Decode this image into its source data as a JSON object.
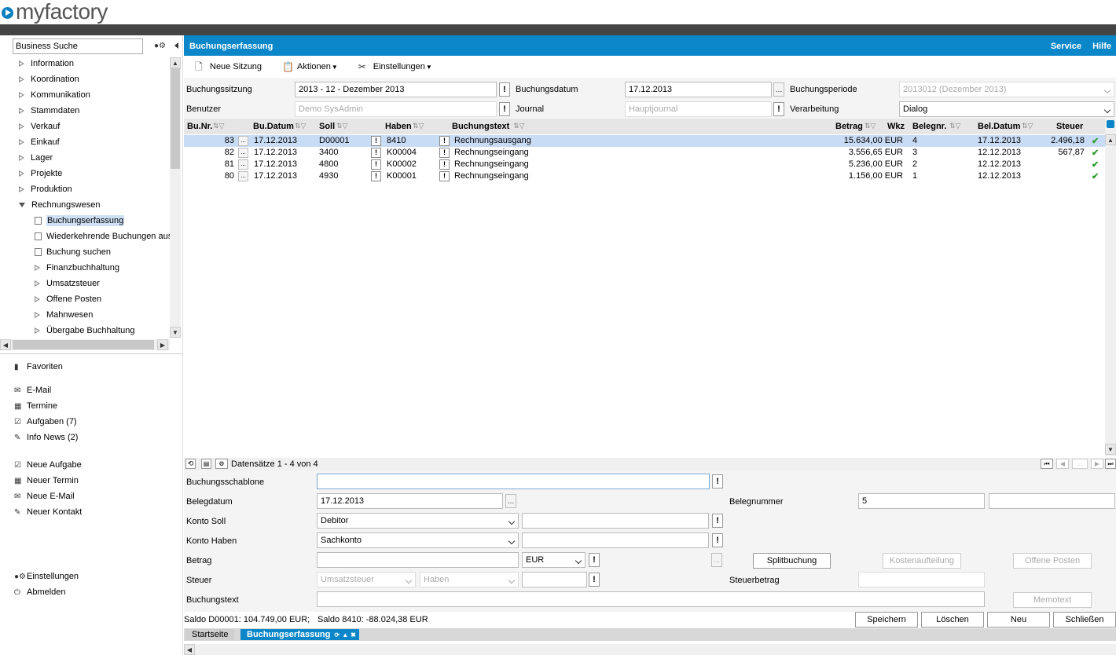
{
  "app": {
    "logo": "myfactory"
  },
  "sidebar": {
    "search_value": "Business Suche",
    "tree": [
      {
        "label": "Information",
        "type": "collapsed"
      },
      {
        "label": "Koordination",
        "type": "collapsed"
      },
      {
        "label": "Kommunikation",
        "type": "collapsed"
      },
      {
        "label": "Stammdaten",
        "type": "collapsed"
      },
      {
        "label": "Verkauf",
        "type": "collapsed"
      },
      {
        "label": "Einkauf",
        "type": "collapsed"
      },
      {
        "label": "Lager",
        "type": "collapsed"
      },
      {
        "label": "Projekte",
        "type": "collapsed"
      },
      {
        "label": "Produktion",
        "type": "collapsed"
      },
      {
        "label": "Rechnungswesen",
        "type": "expanded"
      },
      {
        "label": "Buchungserfassung",
        "type": "doc",
        "selected": true
      },
      {
        "label": "Wiederkehrende Buchungen aus",
        "type": "doc"
      },
      {
        "label": "Buchung suchen",
        "type": "doc"
      },
      {
        "label": "Finanzbuchhaltung",
        "type": "sub"
      },
      {
        "label": "Umsatzsteuer",
        "type": "sub"
      },
      {
        "label": "Offene Posten",
        "type": "sub"
      },
      {
        "label": "Mahnwesen",
        "type": "sub"
      },
      {
        "label": "Übergabe Buchhaltung",
        "type": "sub"
      }
    ],
    "favorites": "Favoriten",
    "links1": [
      {
        "label": "E-Mail",
        "icon": "mail-icon"
      },
      {
        "label": "Termine",
        "icon": "calendar-icon"
      },
      {
        "label": "Aufgaben (7)",
        "icon": "task-icon"
      },
      {
        "label": "Info News (2)",
        "icon": "news-icon"
      }
    ],
    "links2": [
      {
        "label": "Neue Aufgabe",
        "icon": "task-icon"
      },
      {
        "label": "Neuer Termin",
        "icon": "calendar-icon"
      },
      {
        "label": "Neue E-Mail",
        "icon": "mail-icon"
      },
      {
        "label": "Neuer Kontakt",
        "icon": "contact-icon"
      }
    ],
    "settings": "Einstellungen",
    "logout": "Abmelden"
  },
  "header": {
    "title": "Buchungserfassung",
    "service": "Service",
    "help": "Hilfe"
  },
  "toolbar": {
    "new_session": "Neue Sitzung",
    "actions": "Aktionen",
    "settings": "Einstellungen"
  },
  "form": {
    "session_label": "Buchungssitzung",
    "session_value": "2013 - 12 - Dezember 2013",
    "date_label": "Buchungsdatum",
    "date_value": "17.12.2013",
    "period_label": "Buchungsperiode",
    "period_value": "2013012 (Dezember 2013)",
    "user_label": "Benutzer",
    "user_value": "Demo SysAdmin",
    "journal_label": "Journal",
    "journal_value": "Hauptjournal",
    "processing_label": "Verarbeitung",
    "processing_value": "Dialog"
  },
  "grid": {
    "headers": {
      "nr": "Bu.Nr.",
      "datum": "Bu.Datum",
      "soll": "Soll",
      "haben": "Haben",
      "text": "Buchungstext",
      "betrag": "Betrag",
      "wkz": "Wkz",
      "belegnr": "Belegnr.",
      "beldatum": "Bel.Datum",
      "steuer": "Steuer"
    },
    "rows": [
      {
        "nr": "83",
        "datum": "17.12.2013",
        "soll": "D00001",
        "haben": "8410",
        "text": "Rechnungsausgang",
        "betrag": "15.634,00 EUR",
        "belegnr": "4",
        "beldatum": "17.12.2013",
        "steuer": "2.496,18",
        "check": "✔"
      },
      {
        "nr": "82",
        "datum": "17.12.2013",
        "soll": "3400",
        "haben": "K00004",
        "text": "Rechnungseingang",
        "betrag": "3.556,65 EUR",
        "belegnr": "3",
        "beldatum": "12.12.2013",
        "steuer": "567,87",
        "check": "✔"
      },
      {
        "nr": "81",
        "datum": "17.12.2013",
        "soll": "4800",
        "haben": "K00002",
        "text": "Rechnungseingang",
        "betrag": "5.236,00 EUR",
        "belegnr": "2",
        "beldatum": "12.12.2013",
        "steuer": "",
        "check": "✔"
      },
      {
        "nr": "80",
        "datum": "17.12.2013",
        "soll": "4930",
        "haben": "K00001",
        "text": "Rechnungseingang",
        "betrag": "1.156,00 EUR",
        "belegnr": "1",
        "beldatum": "12.12.2013",
        "steuer": "",
        "check": "✔"
      }
    ],
    "status": "Datensätze 1 - 4 von 4"
  },
  "entry": {
    "template_label": "Buchungsschablone",
    "template_value": "",
    "belegdatum_label": "Belegdatum",
    "belegdatum_value": "17.12.2013",
    "belegnummer_label": "Belegnummer",
    "belegnummer_value": "5",
    "soll_label": "Konto Soll",
    "soll_value": "Debitor",
    "haben_label": "Konto Haben",
    "haben_value": "Sachkonto",
    "betrag_label": "Betrag",
    "currency": "EUR",
    "split_button": "Splitbuchung",
    "cost_button": "Kostenaufteilung",
    "open_items_button": "Offene Posten",
    "steuer_label": "Steuer",
    "steuer_value": "Umsatzsteuer",
    "steuer_side": "Haben",
    "steuerbetrag_label": "Steuerbetrag",
    "text_label": "Buchungstext",
    "memo_button": "Memotext"
  },
  "saldo": {
    "soll": "Saldo D00001: 104.749,00 EUR;",
    "haben": "Saldo 8410: -88.024,38 EUR"
  },
  "actions": {
    "save": "Speichern",
    "delete": "Löschen",
    "new": "Neu",
    "close": "Schließen"
  },
  "tabs": [
    {
      "label": "Startseite"
    },
    {
      "label": "Buchungserfassung",
      "active": true
    }
  ]
}
